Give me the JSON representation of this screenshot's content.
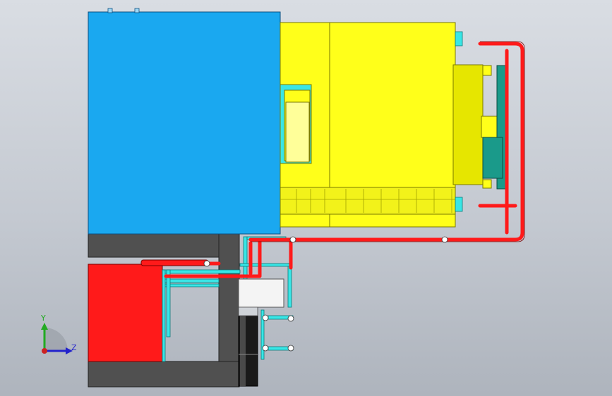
{
  "view": {
    "background_top": "#d9dde3",
    "background_bottom": "#aeb4bd"
  },
  "axis_triad": {
    "y_label": "Y",
    "z_label": "Z",
    "y_color": "#22aa22",
    "z_color": "#2222cc",
    "x_color": "#cc2222"
  },
  "colors": {
    "blue_body": "#1aa8f0",
    "yellow_body": "#ffff1a",
    "red_tank": "#ff1a1a",
    "dark_frame": "#505050",
    "cyan_pipe": "#39e6e6",
    "red_pipe": "#ff1a1a",
    "teal_part": "#1a9a8a"
  }
}
